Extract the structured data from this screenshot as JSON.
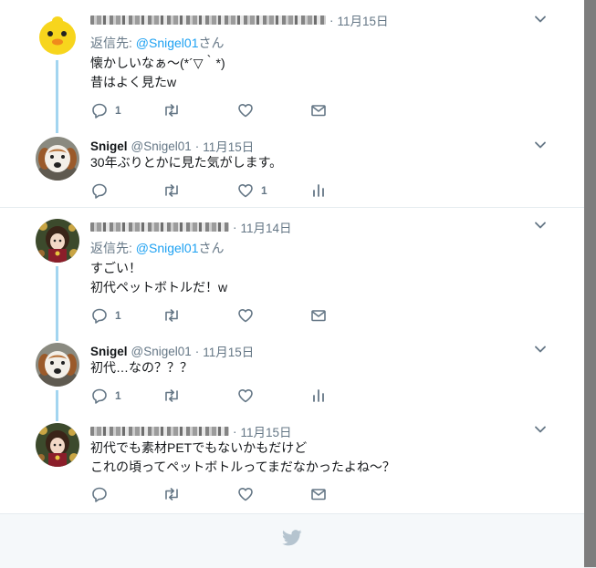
{
  "conversations": [
    {
      "tweets": [
        {
          "author_name": "",
          "handle": "",
          "separator": "·",
          "date": "11月15日",
          "reply_prefix": "返信先: ",
          "reply_handle": "@Snigel01",
          "reply_suffix": "さん",
          "text": "懐かしいなぁ〜(*´▽｀*)\n昔はよく見たw",
          "reply_count": "1",
          "retweet_count": "",
          "like_count": "",
          "avatar": "yellow-chick",
          "has_analytics": false
        },
        {
          "author_name": "Snigel",
          "handle": "@Snigel01",
          "separator": "·",
          "date": "11月15日",
          "text": "30年ぶりとかに見た気がします。",
          "reply_count": "",
          "retweet_count": "",
          "like_count": "1",
          "avatar": "dog",
          "has_analytics": true
        }
      ]
    },
    {
      "tweets": [
        {
          "author_name": "",
          "handle": "",
          "separator": "·",
          "date": "11月14日",
          "reply_prefix": "返信先: ",
          "reply_handle": "@Snigel01",
          "reply_suffix": "さん",
          "text": "すごい！\n初代ペットボトルだ！w",
          "reply_count": "1",
          "retweet_count": "",
          "like_count": "",
          "avatar": "anime-character",
          "has_analytics": false
        },
        {
          "author_name": "Snigel",
          "handle": "@Snigel01",
          "separator": "·",
          "date": "11月15日",
          "text": "初代…なの？？？",
          "reply_count": "1",
          "retweet_count": "",
          "like_count": "",
          "avatar": "dog",
          "has_analytics": true
        },
        {
          "author_name": "",
          "handle": "",
          "separator": "·",
          "date": "11月15日",
          "text": "初代でも素材PETでもないかもだけど\nこれの頃ってペットボトルってまだなかったよね〜？",
          "reply_count": "",
          "retweet_count": "",
          "like_count": "",
          "avatar": "anime-character",
          "has_analytics": false
        }
      ]
    }
  ],
  "icons": {
    "reply": "reply-icon",
    "retweet": "retweet-icon",
    "like": "heart-icon",
    "dm": "envelope-icon",
    "analytics": "analytics-icon",
    "menu": "chevron-down-icon",
    "footer": "twitter-bird-icon"
  },
  "colors": {
    "link": "#1da1f2",
    "muted": "#657786",
    "thread_line": "#a3d5f0",
    "background": "#e6ecf0"
  }
}
